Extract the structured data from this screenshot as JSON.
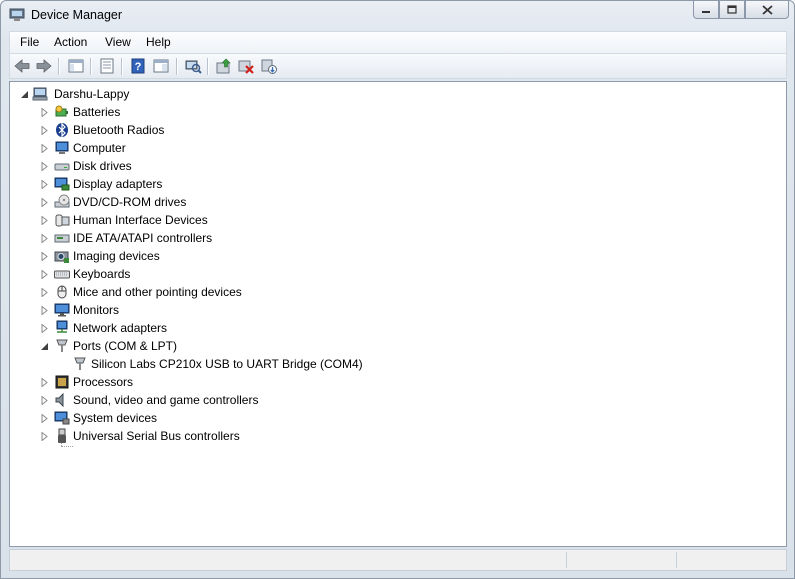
{
  "window": {
    "title": "Device Manager",
    "icon": "device-manager-icon",
    "controls": {
      "minimize": "minimize-icon",
      "maximize": "maximize-icon",
      "close": "close-icon"
    }
  },
  "menu": [
    "File",
    "Action",
    "View",
    "Help"
  ],
  "toolbar": [
    "back-icon",
    "forward-icon",
    "show-hide-console-tree-icon",
    "properties-icon",
    "help-icon",
    "show-action-pane-icon",
    "scan-hardware-changes-icon",
    "update-driver-icon",
    "uninstall-device-icon",
    "disable-device-icon"
  ],
  "tree": {
    "root": "Darshu-Lappy",
    "categories": [
      {
        "label": "Batteries",
        "icon": "battery-icon",
        "expanded": false
      },
      {
        "label": "Bluetooth Radios",
        "icon": "bluetooth-icon",
        "expanded": false
      },
      {
        "label": "Computer",
        "icon": "computer-icon",
        "expanded": false
      },
      {
        "label": "Disk drives",
        "icon": "disk-drive-icon",
        "expanded": false
      },
      {
        "label": "Display adapters",
        "icon": "display-adapter-icon",
        "expanded": false
      },
      {
        "label": "DVD/CD-ROM drives",
        "icon": "dvd-drive-icon",
        "expanded": false
      },
      {
        "label": "Human Interface Devices",
        "icon": "hid-icon",
        "expanded": false
      },
      {
        "label": "IDE ATA/ATAPI controllers",
        "icon": "ide-controller-icon",
        "expanded": false
      },
      {
        "label": "Imaging devices",
        "icon": "camera-icon",
        "expanded": false
      },
      {
        "label": "Keyboards",
        "icon": "keyboard-icon",
        "expanded": false
      },
      {
        "label": "Mice and other pointing devices",
        "icon": "mouse-icon",
        "expanded": false
      },
      {
        "label": "Monitors",
        "icon": "monitor-icon",
        "expanded": false
      },
      {
        "label": "Network adapters",
        "icon": "network-adapter-icon",
        "expanded": false
      },
      {
        "label": "Ports (COM & LPT)",
        "icon": "port-icon",
        "expanded": true,
        "children": [
          "Silicon Labs CP210x USB to UART Bridge (COM4)"
        ]
      },
      {
        "label": "Processors",
        "icon": "processor-icon",
        "expanded": false
      },
      {
        "label": "Sound, video and game controllers",
        "icon": "speaker-icon",
        "expanded": false
      },
      {
        "label": "System devices",
        "icon": "system-device-icon",
        "expanded": false
      },
      {
        "label": "Universal Serial Bus controllers",
        "icon": "usb-icon",
        "expanded": false
      }
    ]
  },
  "colors": {
    "window_frame": "#dfe6ee",
    "content_bg": "#ffffff",
    "status_bg": "#f0f0f0"
  }
}
